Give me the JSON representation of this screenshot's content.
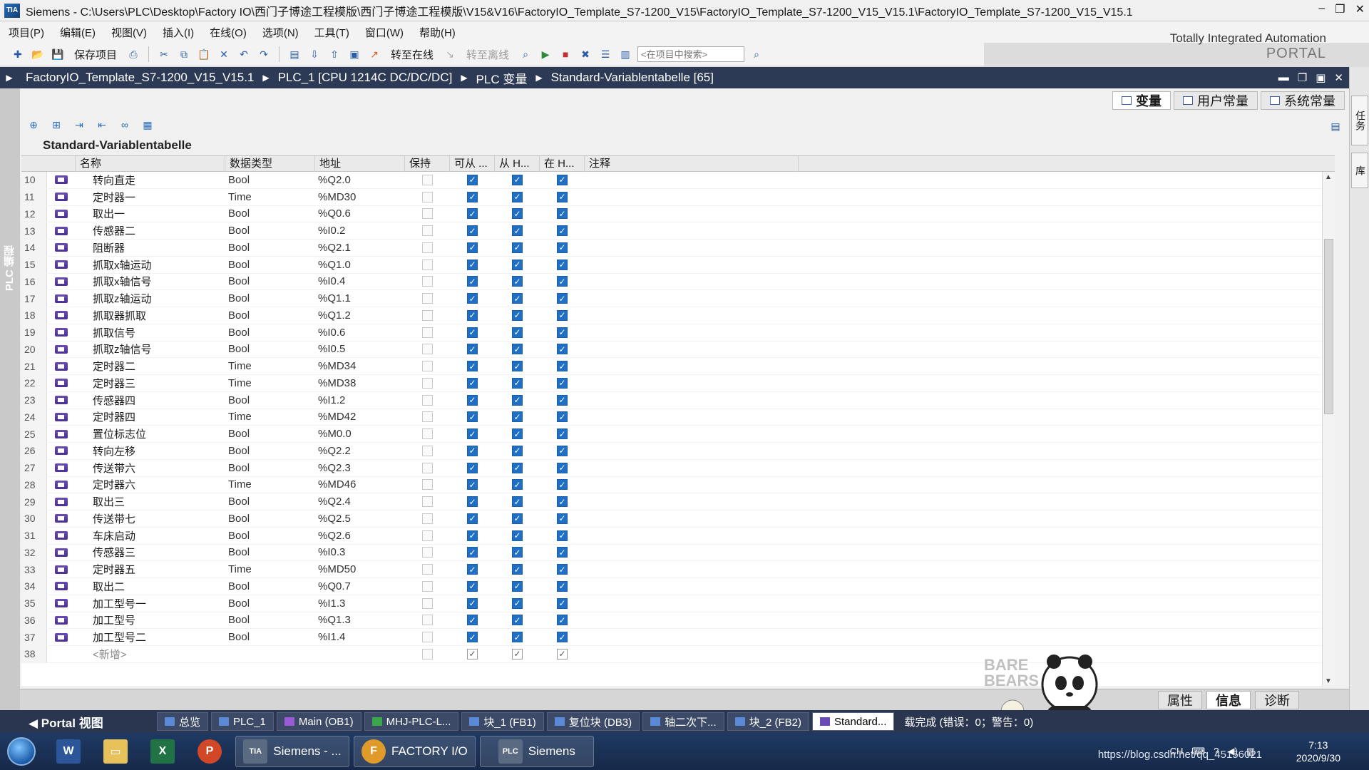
{
  "window": {
    "app_name": "Siemens",
    "title": "Siemens  -  C:\\Users\\PLC\\Desktop\\Factory IO\\西门子博途工程模版\\西门子博途工程模版\\V15&V16\\FactoryIO_Template_S7-1200_V15\\FactoryIO_Template_S7-1200_V15_V15.1\\FactoryIO_Template_S7-1200_V15_V15.1"
  },
  "menu": [
    "项目(P)",
    "编辑(E)",
    "视图(V)",
    "插入(I)",
    "在线(O)",
    "选项(N)",
    "工具(T)",
    "窗口(W)",
    "帮助(H)"
  ],
  "brand": {
    "line1": "Totally Integrated Automation",
    "line2": "PORTAL"
  },
  "toolbar": {
    "save_label": "保存项目",
    "go_online": "转至在线",
    "go_offline": "转至离线",
    "search_placeholder": "<在项目中搜索>"
  },
  "breadcrumb": [
    "FactoryIO_Template_S7-1200_V15_V15.1",
    "PLC_1 [CPU 1214C DC/DC/DC]",
    "PLC 变量",
    "Standard-Variablentabelle [65]"
  ],
  "type_tabs": [
    "变量",
    "用户常量",
    "系统常量"
  ],
  "table": {
    "title": "Standard-Variablentabelle",
    "headers": {
      "name": "名称",
      "type": "数据类型",
      "address": "地址",
      "retain": "保持",
      "accessible": "可从 ...",
      "writable": "从 H...",
      "visible": "在 H...",
      "comment": "注释"
    },
    "rows": [
      {
        "num": "10",
        "name": "转向直走",
        "type": "Bool",
        "addr": "%Q2.0"
      },
      {
        "num": "11",
        "name": "定时器一",
        "type": "Time",
        "addr": "%MD30"
      },
      {
        "num": "12",
        "name": "取出一",
        "type": "Bool",
        "addr": "%Q0.6"
      },
      {
        "num": "13",
        "name": "传感器二",
        "type": "Bool",
        "addr": "%I0.2"
      },
      {
        "num": "14",
        "name": "阻断器",
        "type": "Bool",
        "addr": "%Q2.1"
      },
      {
        "num": "15",
        "name": "抓取x轴运动",
        "type": "Bool",
        "addr": "%Q1.0"
      },
      {
        "num": "16",
        "name": "抓取x轴信号",
        "type": "Bool",
        "addr": "%I0.4"
      },
      {
        "num": "17",
        "name": "抓取z轴运动",
        "type": "Bool",
        "addr": "%Q1.1"
      },
      {
        "num": "18",
        "name": "抓取器抓取",
        "type": "Bool",
        "addr": "%Q1.2"
      },
      {
        "num": "19",
        "name": "抓取信号",
        "type": "Bool",
        "addr": "%I0.6"
      },
      {
        "num": "20",
        "name": "抓取z轴信号",
        "type": "Bool",
        "addr": "%I0.5"
      },
      {
        "num": "21",
        "name": "定时器二",
        "type": "Time",
        "addr": "%MD34"
      },
      {
        "num": "22",
        "name": "定时器三",
        "type": "Time",
        "addr": "%MD38"
      },
      {
        "num": "23",
        "name": "传感器四",
        "type": "Bool",
        "addr": "%I1.2"
      },
      {
        "num": "24",
        "name": "定时器四",
        "type": "Time",
        "addr": "%MD42"
      },
      {
        "num": "25",
        "name": "置位标志位",
        "type": "Bool",
        "addr": "%M0.0"
      },
      {
        "num": "26",
        "name": "转向左移",
        "type": "Bool",
        "addr": "%Q2.2"
      },
      {
        "num": "27",
        "name": "传送带六",
        "type": "Bool",
        "addr": "%Q2.3"
      },
      {
        "num": "28",
        "name": "定时器六",
        "type": "Time",
        "addr": "%MD46"
      },
      {
        "num": "29",
        "name": "取出三",
        "type": "Bool",
        "addr": "%Q2.4"
      },
      {
        "num": "30",
        "name": "传送带七",
        "type": "Bool",
        "addr": "%Q2.5"
      },
      {
        "num": "31",
        "name": "车床启动",
        "type": "Bool",
        "addr": "%Q2.6"
      },
      {
        "num": "32",
        "name": "传感器三",
        "type": "Bool",
        "addr": "%I0.3"
      },
      {
        "num": "33",
        "name": "定时器五",
        "type": "Time",
        "addr": "%MD50"
      },
      {
        "num": "34",
        "name": "取出二",
        "type": "Bool",
        "addr": "%Q0.7"
      },
      {
        "num": "35",
        "name": "加工型号一",
        "type": "Bool",
        "addr": "%I1.3"
      },
      {
        "num": "36",
        "name": "加工型号",
        "type": "Bool",
        "addr": "%Q1.3"
      },
      {
        "num": "37",
        "name": "加工型号二",
        "type": "Bool",
        "addr": "%I1.4"
      }
    ],
    "new_row": {
      "num": "38",
      "name": "<新增>"
    }
  },
  "inspector_tabs": [
    "属性",
    "信息",
    "诊断"
  ],
  "left_strip_label": "PLC 编程",
  "right_strip_tabs": [
    "任务",
    "库"
  ],
  "portal_view": "Portal 视图",
  "editor_tabs": [
    "总览",
    "PLC_1",
    "Main (OB1)",
    "MHJ-PLC-L...",
    "块_1 (FB1)",
    "复位块 (DB3)",
    "轴二次下...",
    "块_2 (FB2)",
    "Standard..."
  ],
  "status": "载完成 (错误：0；警告：0)",
  "taskbar": {
    "apps": [
      "Siemens - ...",
      "FACTORY I/O",
      "Siemens"
    ],
    "tray_lang": "CH",
    "time": "7:13",
    "date": "2020/9/30"
  },
  "watermark": "https://blog.csdn.net/qq_45156021",
  "colors": {
    "accent": "#1f6fc6",
    "breadcrumb_bg": "#2c3a55",
    "taskbar_bg": "#1f3a63"
  }
}
